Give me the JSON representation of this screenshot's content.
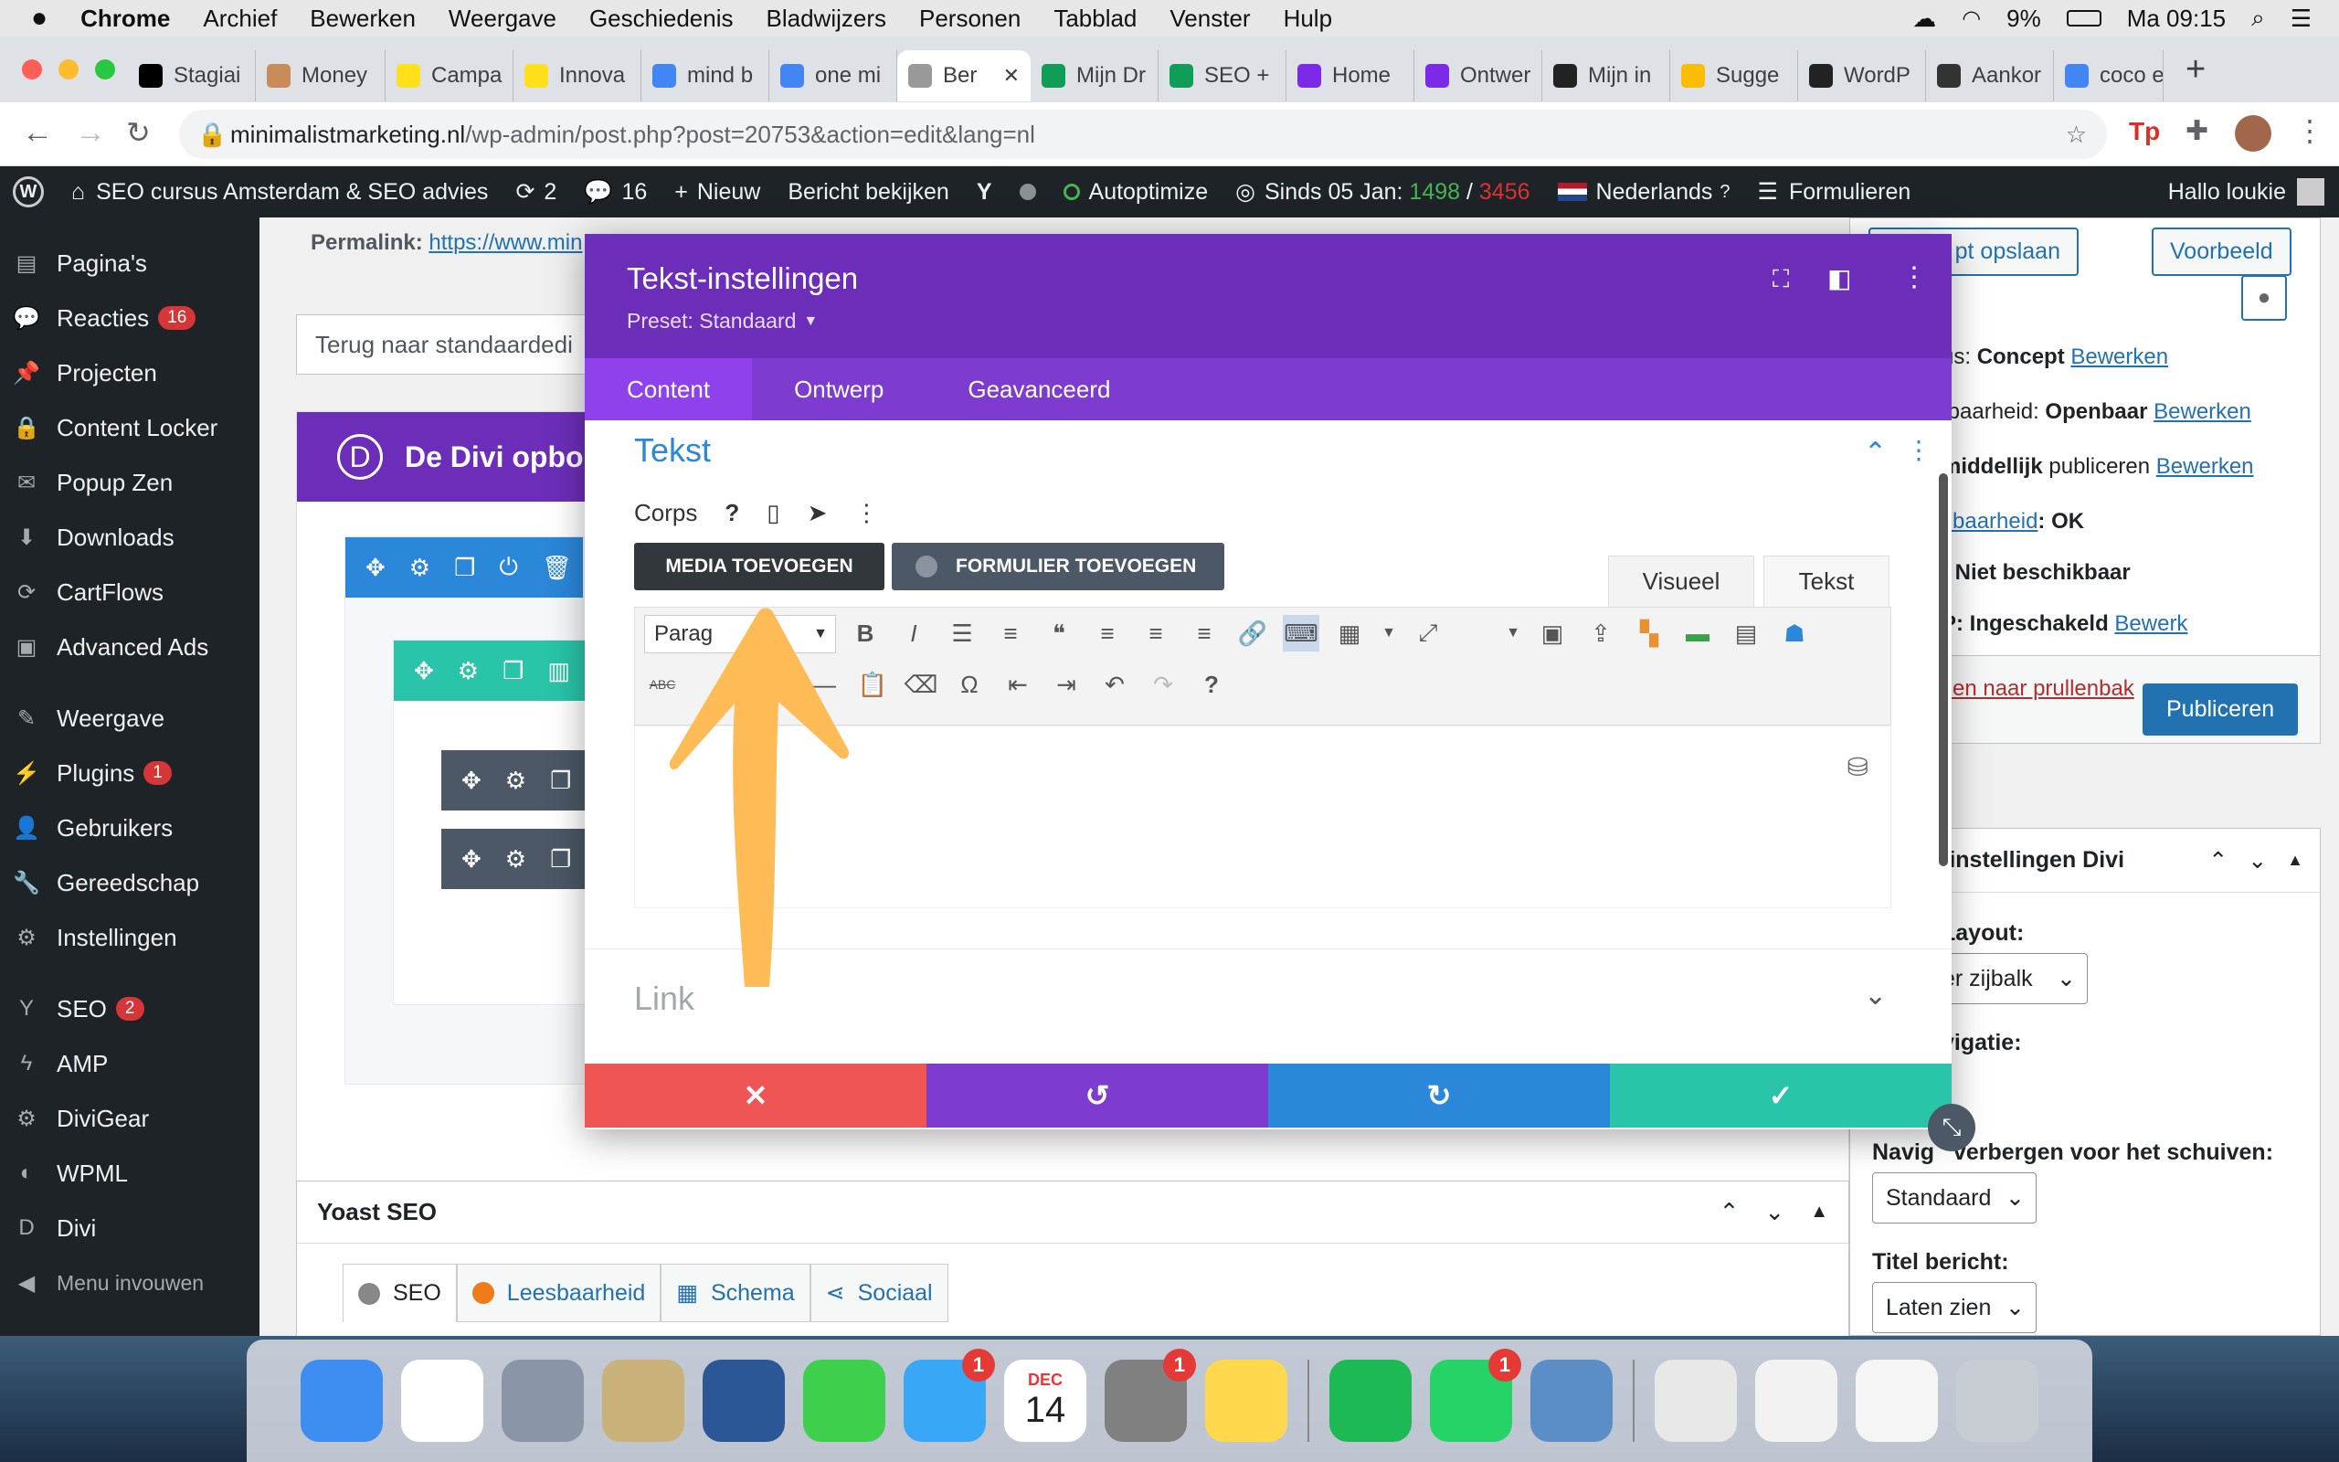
{
  "mac_menu": {
    "app": "Chrome",
    "items": [
      "Archief",
      "Bewerken",
      "Weergave",
      "Geschiedenis",
      "Bladwijzers",
      "Personen",
      "Tabblad",
      "Venster",
      "Hulp"
    ],
    "battery": "9%",
    "clock": "Ma 09:15"
  },
  "browser": {
    "tabs": [
      {
        "label": "Stagiai",
        "icon": "notion-icon",
        "color": "#000000"
      },
      {
        "label": "Money",
        "icon": "avatar-icon",
        "color": "#c98b5a"
      },
      {
        "label": "Campa",
        "icon": "mailchimp-icon",
        "color": "#ffe01b"
      },
      {
        "label": "Innova",
        "icon": "mailchimp-icon",
        "color": "#ffe01b"
      },
      {
        "label": "mind b",
        "icon": "google-icon",
        "color": "#4285f4"
      },
      {
        "label": "one mi",
        "icon": "google-icon",
        "color": "#4285f4"
      },
      {
        "label": "Ber",
        "icon": "page-icon",
        "color": "#999999",
        "active": true
      },
      {
        "label": "Mijn Dr",
        "icon": "drive-icon",
        "color": "#0f9d58"
      },
      {
        "label": "SEO +",
        "icon": "sheets-icon",
        "color": "#0f9d58"
      },
      {
        "label": "Home",
        "icon": "canva-icon",
        "color": "#7d2ae8"
      },
      {
        "label": "Ontwer",
        "icon": "canva-icon",
        "color": "#7d2ae8"
      },
      {
        "label": "Mijn in",
        "icon": "ring-icon",
        "color": "#222222"
      },
      {
        "label": "Sugge",
        "icon": "ads-icon",
        "color": "#fbbc04"
      },
      {
        "label": "WordP",
        "icon": "w-icon",
        "color": "#222222"
      },
      {
        "label": "Aankor",
        "icon": "calendar-icon",
        "color": "#333333"
      },
      {
        "label": "coco e",
        "icon": "google-icon",
        "color": "#4285f4"
      }
    ],
    "url_domain": "minimalistmarketing.nl",
    "url_path": "/wp-admin/post.php?post=20753&action=edit&lang=nl"
  },
  "wp_adminbar": {
    "site": "SEO cursus Amsterdam & SEO advies",
    "updates": "2",
    "comments": "16",
    "new": "Nieuw",
    "view_post": "Bericht bekijken",
    "autoptimize": "Autoptimize",
    "since": "Sinds 05 Jan:",
    "count_green": "1498",
    "slash": "/",
    "count_red": "3456",
    "language": "Nederlands",
    "forms": "Formulieren",
    "greeting": "Hallo loukie"
  },
  "sidebar": {
    "items": [
      {
        "label": "Pagina's",
        "icon": "pages-icon"
      },
      {
        "label": "Reacties",
        "icon": "comments-icon",
        "badge": "16"
      },
      {
        "label": "Projecten",
        "icon": "pin-icon"
      },
      {
        "label": "Content Locker",
        "icon": "lock-icon"
      },
      {
        "label": "Popup Zen",
        "icon": "mail-icon"
      },
      {
        "label": "Downloads",
        "icon": "download-icon"
      },
      {
        "label": "CartFlows",
        "icon": "cart-icon"
      },
      {
        "label": "Advanced Ads",
        "icon": "ads-icon"
      },
      {
        "label": "Weergave",
        "icon": "brush-icon"
      },
      {
        "label": "Plugins",
        "icon": "plug-icon",
        "badge": "1"
      },
      {
        "label": "Gebruikers",
        "icon": "user-icon"
      },
      {
        "label": "Gereedschap",
        "icon": "wrench-icon"
      },
      {
        "label": "Instellingen",
        "icon": "settings-icon"
      },
      {
        "label": "SEO",
        "icon": "yoast-icon",
        "badge": "2"
      },
      {
        "label": "AMP",
        "icon": "amp-icon"
      },
      {
        "label": "DiviGear",
        "icon": "gear-icon"
      },
      {
        "label": "WPML",
        "icon": "wpml-icon"
      },
      {
        "label": "Divi",
        "icon": "divi-icon"
      },
      {
        "label": "Menu invouwen",
        "icon": "collapse-icon"
      }
    ]
  },
  "editor": {
    "permalink_label": "Permalink:",
    "permalink_url": "https://www.min",
    "back_button": "Terug naar standaardedi",
    "divi_title": "De Divi opbo"
  },
  "right": {
    "save_draft": "pt opslaan",
    "preview": "Voorbeeld",
    "status_label": "us:",
    "status_value": "Concept",
    "edit": "Bewerken",
    "visibility_label": "tbaarheid:",
    "visibility_value": "Openbaar",
    "publish_label": "middellijk",
    "publish_word": "publiceren",
    "readability_link": "sbaarheid",
    "readability_value": ": OK",
    "unavailable": ": Niet beschikbaar",
    "enabled_label": "P:",
    "enabled_value": "Ingeschakeld",
    "edit_short": "Bewerk",
    "trash": "sen naar prullenbak",
    "publish_button": "Publiceren",
    "divi_settings": "-instellingen Divi",
    "layout_label": "Layout:",
    "layout_value": "er zijbalk",
    "nav_label": "vigatie:",
    "hide_nav_label": "Navig   verbergen voor het schuiven:",
    "hide_nav_value": "Standaard",
    "title_label": "Titel bericht:",
    "title_value": "Laten zien"
  },
  "yoast": {
    "title": "Yoast SEO",
    "tabs": [
      "SEO",
      "Leesbaarheid",
      "Schema",
      "Sociaal"
    ]
  },
  "modal": {
    "title": "Tekst-instellingen",
    "preset": "Preset: Standaard",
    "tabs": [
      "Content",
      "Ontwerp",
      "Geavanceerd"
    ],
    "section_title": "Tekst",
    "corps_label": "Corps",
    "help_glyph": "?",
    "add_media": "MEDIA TOEVOEGEN",
    "add_form": "FORMULIER TOEVOEGEN",
    "mode_visual": "Visueel",
    "mode_text": "Tekst",
    "paragraph_select": "Parag",
    "abc": "ABC",
    "link_section": "Link"
  },
  "dock": {
    "calendar_month": "DEC",
    "calendar_day": "14",
    "apps": [
      {
        "name": "finder-icon",
        "color": "#3d8ef0"
      },
      {
        "name": "chrome-icon",
        "color": "#ffffff"
      },
      {
        "name": "launchpad-icon",
        "color": "#8a96a8"
      },
      {
        "name": "preview-icon",
        "color": "#c9b27a"
      },
      {
        "name": "word-icon",
        "color": "#2b5797"
      },
      {
        "name": "facetime-icon",
        "color": "#3ecf4c"
      },
      {
        "name": "messages-icon",
        "color": "#38a7f5",
        "badge": "1"
      },
      {
        "name": "calendar-icon",
        "color": "#ffffff"
      },
      {
        "name": "system-preferences-icon",
        "color": "#808080",
        "badge": "1"
      },
      {
        "name": "notes-icon",
        "color": "#ffd84d"
      },
      {
        "name": "spotify-icon",
        "color": "#1db954"
      },
      {
        "name": "whatsapp-icon",
        "color": "#25d366",
        "badge": "1"
      },
      {
        "name": "photos-icon",
        "color": "#5b8ec6"
      },
      {
        "name": "document-icon",
        "color": "#e8e8e8"
      },
      {
        "name": "document-icon",
        "color": "#f2f2f2"
      },
      {
        "name": "calendar-doc-icon",
        "color": "#f5f5f5"
      },
      {
        "name": "trash-icon",
        "color": "#c8cdd4"
      }
    ]
  },
  "colors": {
    "divi_purple": "#6c2eb9",
    "divi_blue": "#2b87da",
    "divi_teal": "#29c4a9",
    "wp_blue": "#2271b1",
    "annotation_orange": "#ffb74d"
  }
}
